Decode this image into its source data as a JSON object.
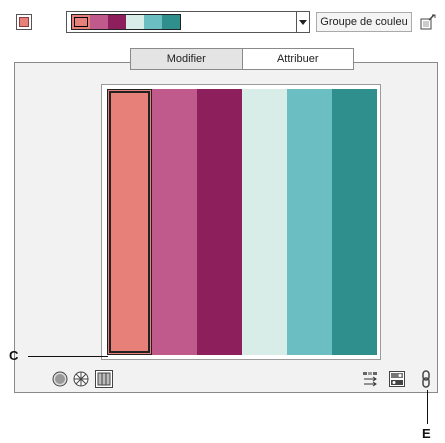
{
  "toolbar": {
    "active_color": "#e8807a",
    "group_strip_colors": [
      "#e8807a",
      "#c05a8c",
      "#8c1f5c",
      "#d8ede8",
      "#6bbfc2",
      "#2f8f8c"
    ],
    "group_button_label": "Groupe de couleu",
    "new_group_icon": "new-group-icon"
  },
  "tabs": {
    "modify_label": "Modifier",
    "assign_label": "Attribuer"
  },
  "bars": {
    "colors": [
      "#e8807a",
      "#c05a8c",
      "#8c1f5c",
      "#d8ede8",
      "#6bbfc2",
      "#2f8f8c"
    ],
    "selected_index": 0
  },
  "bottom_tools": {
    "left_icons": [
      "hsb-circle-icon",
      "color-wheel-icon",
      "bars-view-icon"
    ],
    "right_icons": [
      "shuffle-colors-icon",
      "randomize-saturation-icon",
      "link-harmony-icon"
    ]
  },
  "callouts": {
    "c_label": "C",
    "e_label": "E"
  }
}
